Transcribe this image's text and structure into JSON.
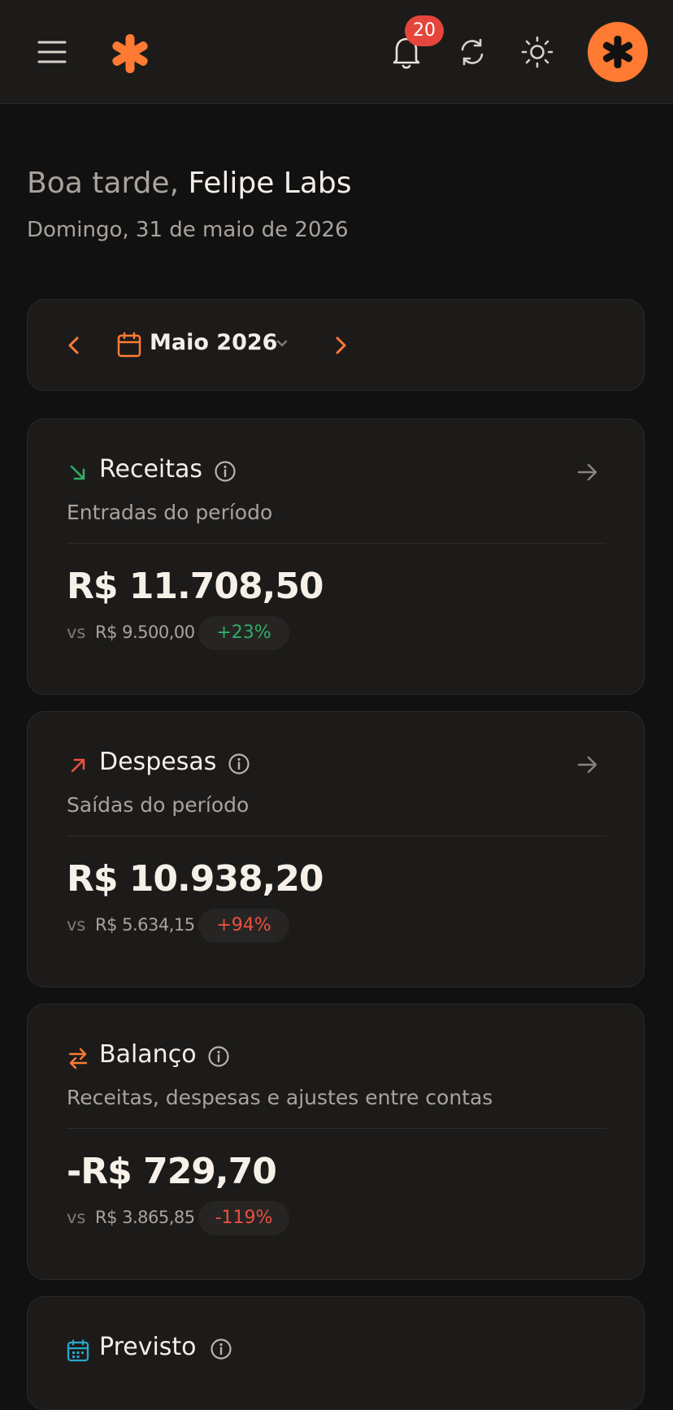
{
  "header": {
    "menu_icon": "hamburger-icon",
    "logo_icon": "asterisk-logo",
    "notifications_icon": "bell-icon",
    "notification_count": "20",
    "sync_icon": "sync-icon",
    "theme_icon": "sun-icon",
    "avatar_icon": "asterisk-avatar"
  },
  "greeting": {
    "salutation": "Boa tarde,",
    "name": "Felipe Labs",
    "date": "Domingo, 31 de maio de 2026"
  },
  "period": {
    "label": "Maio 2026",
    "prev_icon": "chevron-left-icon",
    "next_icon": "chevron-right-icon",
    "calendar_icon": "calendar-icon"
  },
  "colors": {
    "accent": "#ff7a32",
    "positive": "#2fae64",
    "negative": "#ea5141",
    "background": "#121111",
    "card": "#1c1b1a"
  },
  "cards": [
    {
      "title": "Receitas",
      "subtitle": "Entradas do período",
      "amount": "R$ 11.708,50",
      "vs_label": "vs",
      "previous": "R$ 9.500,00",
      "change": "+23%"
    },
    {
      "title": "Despesas",
      "subtitle": "Saídas do período",
      "amount": "R$ 10.938,20",
      "vs_label": "vs",
      "previous": "R$ 5.634,15",
      "change": "+94%"
    },
    {
      "title": "Balanço",
      "subtitle": "Receitas, despesas e ajustes entre contas",
      "amount": "-R$ 729,70",
      "vs_label": "vs",
      "previous": "R$ 3.865,85",
      "change": "-119%"
    },
    {
      "title": "Previsto"
    }
  ]
}
